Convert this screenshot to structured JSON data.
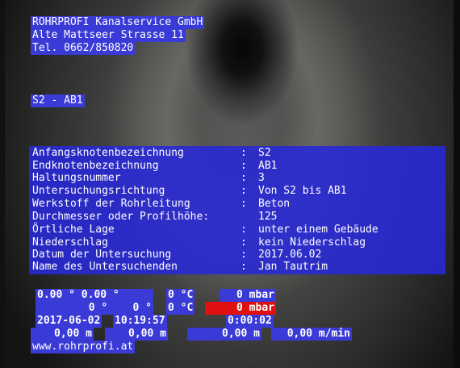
{
  "company": {
    "name": "ROHRPROFI Kanalservice GmbH",
    "street": "Alte Mattseer Strasse 11",
    "phone": "Tel. 0662/850820"
  },
  "section_label": "S2 - AB1",
  "info": [
    {
      "label": "Anfangsknotenbezeichnung",
      "value": "S2"
    },
    {
      "label": "Endknotenbezeichnung",
      "value": "AB1"
    },
    {
      "label": "Haltungsnummer",
      "value": "3"
    },
    {
      "label": "Untersuchungsrichtung",
      "value": "Von S2 bis AB1"
    },
    {
      "label": "Werkstoff der Rohrleitung",
      "value": "Beton"
    },
    {
      "label": "Durchmesser oder Profilhöhe:",
      "value": "125"
    },
    {
      "label": "Örtliche Lage",
      "value": "unter einem Gebäude"
    },
    {
      "label": "Niederschlag",
      "value": "kein Niederschlag"
    },
    {
      "label": "Datum der Untersuchung",
      "value": "2017.06.02"
    },
    {
      "label": "Name des Untersuchenden",
      "value": "Jan Tautrim"
    }
  ],
  "separator": ":",
  "telemetry": {
    "row1": {
      "a": "0.00 ° 0.00 °",
      "b": "0 °C",
      "c": "0 mbar"
    },
    "row2": {
      "a": "0 °    0 °",
      "b": "0 °C",
      "c": "0 mbar"
    },
    "row3": {
      "date": "2017-06-02",
      "time": "10:19:57",
      "elapsed": "0:00:02"
    },
    "row4": {
      "a": "0,00 m",
      "b": "0,00 m",
      "c": "0,00 m",
      "d": "0,00 m/min"
    },
    "website": "www.rohrprofi.at"
  },
  "colors": {
    "overlay": "#2828d7",
    "alert": "#e01010",
    "text": "#ffffff"
  }
}
